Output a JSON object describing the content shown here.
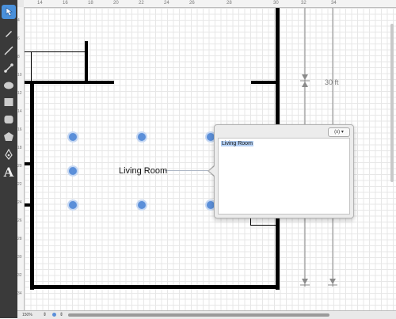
{
  "tools": [
    {
      "name": "selection-tool",
      "icon": "pointer-hand-icon",
      "active": true
    },
    {
      "name": "pen-tool",
      "icon": "pen-icon",
      "active": false
    },
    {
      "name": "line-tool",
      "icon": "line-icon",
      "active": false
    },
    {
      "name": "connector-tool",
      "icon": "connector-icon",
      "active": false
    },
    {
      "name": "ellipse-tool",
      "icon": "ellipse-icon",
      "active": false
    },
    {
      "name": "rectangle-tool",
      "icon": "rectangle-icon",
      "active": false
    },
    {
      "name": "rounded-rectangle-tool",
      "icon": "rounded-rectangle-icon",
      "active": false
    },
    {
      "name": "polygon-tool",
      "icon": "polygon-icon",
      "active": false
    },
    {
      "name": "bezier-tool",
      "icon": "bezier-pen-icon",
      "active": false
    },
    {
      "name": "text-tool",
      "icon": "text-icon",
      "active": false
    }
  ],
  "text_tool_glyph": "A",
  "ruler": {
    "top_labels": [
      "14",
      "16",
      "18",
      "20",
      "22",
      "24",
      "26",
      "28",
      "30",
      "32",
      "34"
    ],
    "left_labels": [
      "4",
      "6",
      "8",
      "10",
      "12",
      "14",
      "16",
      "18",
      "20",
      "22",
      "24",
      "26",
      "28",
      "30",
      "32",
      "34"
    ]
  },
  "canvas": {
    "room_label": "Living Room",
    "dimension_label": "30 ft"
  },
  "popover": {
    "variable_button": "(x) ▾",
    "text_value": "Living Room"
  },
  "status": {
    "zoom": "150%"
  },
  "colors": {
    "toolbar": "#3a3a3a",
    "accent": "#4a90d9",
    "handle": "#5b8fd9",
    "selection_highlight": "#b5d1f5"
  }
}
